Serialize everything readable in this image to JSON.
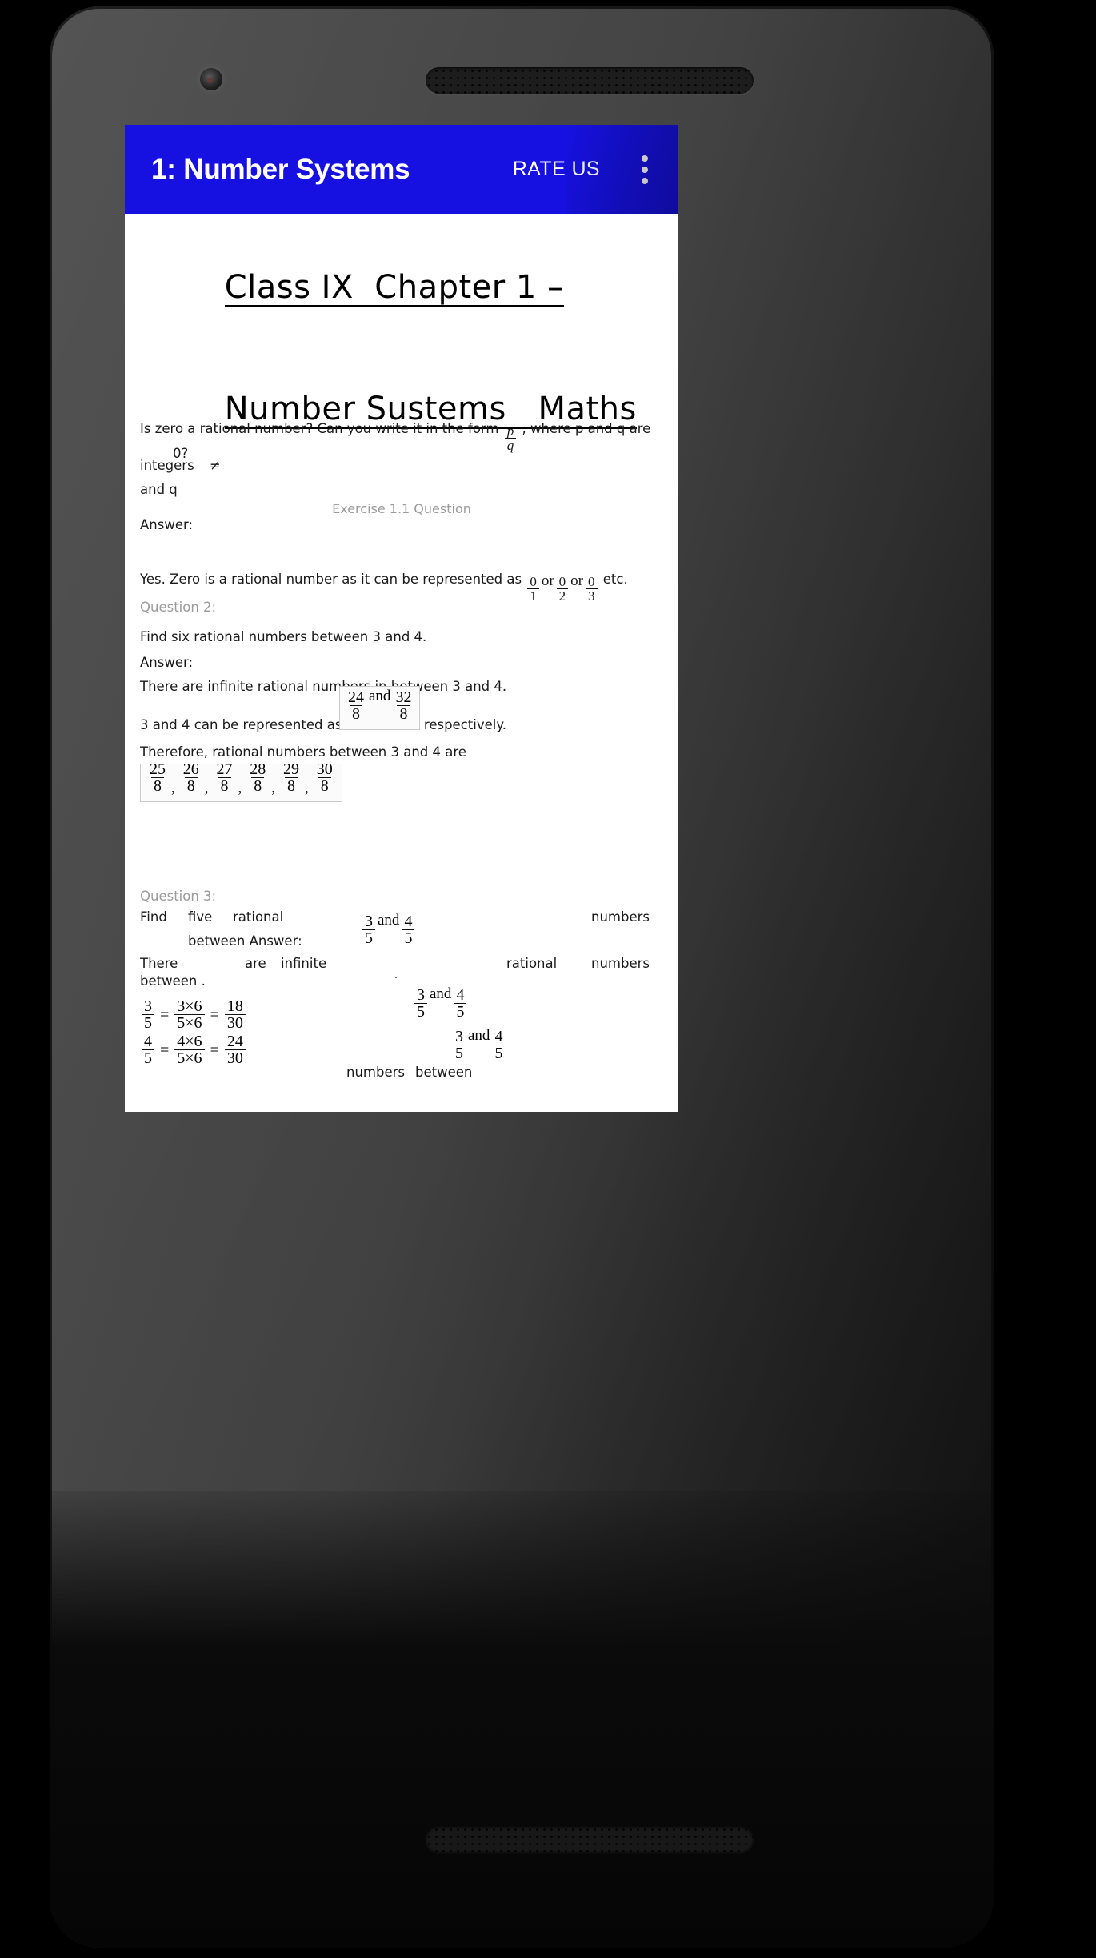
{
  "device": {
    "name": "android-phone-mockup",
    "camera_icon": "front-camera-icon",
    "earpiece_icon": "earpiece-speaker-icon",
    "bottom_speaker_icon": "bottom-speaker-icon",
    "volume_button": "volume-rocker",
    "power_button": "power-button"
  },
  "appbar": {
    "title": "1: Number Systems",
    "rate_us_label": "RATE US",
    "overflow_icon": "more-vert-icon",
    "background_color": "#1611e0",
    "text_color": "#ffffff"
  },
  "document": {
    "heading_line1": "Class IX  Chapter 1 –",
    "heading_line2": "Number Sustems   Maths",
    "exercise_label": "Exercise 1.1 Question",
    "question1": {
      "text_before_fraction": "Is zero a rational number? Can you write it in the form",
      "fraction": {
        "numerator": "p",
        "denominator": "q"
      },
      "text_after_fraction": ", where p and q are integers",
      "neq_symbol": "≠",
      "zero_q": "0?",
      "wrap_fragment": "and q",
      "answer_label": "Answer:",
      "answer_text_before": "Yes. Zero is a rational number as it can be represented as",
      "answer_fractions": [
        {
          "numerator": "0",
          "denominator": "1"
        },
        {
          "numerator": "0",
          "denominator": "2"
        },
        {
          "numerator": "0",
          "denominator": "3"
        }
      ],
      "or_label": "or",
      "answer_text_after": "etc."
    },
    "question2": {
      "label": "Question 2:",
      "text": "Find six rational numbers between 3 and 4.",
      "answer_label": "Answer:",
      "line1": "There are infinite rational numbers in between 3 and 4.",
      "line2_before": "3 and 4 can be represented as",
      "boxed_fractions": [
        {
          "numerator": "24",
          "denominator": "8"
        },
        {
          "numerator": "32",
          "denominator": "8"
        }
      ],
      "and_label": "and",
      "line2_after": "respectively.",
      "line3": "Therefore, rational numbers between 3 and 4 are",
      "result_fractions": [
        {
          "numerator": "25",
          "denominator": "8"
        },
        {
          "numerator": "26",
          "denominator": "8"
        },
        {
          "numerator": "27",
          "denominator": "8"
        },
        {
          "numerator": "28",
          "denominator": "8"
        },
        {
          "numerator": "29",
          "denominator": "8"
        },
        {
          "numerator": "30",
          "denominator": "8"
        }
      ],
      "separator": ","
    },
    "question3": {
      "label": "Question 3:",
      "line1_a": "Find",
      "line1_b": "five",
      "line1_c": "rational",
      "line1_d": "numbers",
      "line2_a": "between Answer:",
      "pair_fraction_left": {
        "numerator": "3",
        "denominator": "5"
      },
      "pair_fraction_right": {
        "numerator": "4",
        "denominator": "5"
      },
      "and_label": "and",
      "line3_a": "There",
      "line3_b": "are",
      "line3_c": "infinite",
      "line3_d": "rational",
      "line3_e": "numbers",
      "line4": "between .",
      "period_mark": ".",
      "equations": [
        {
          "lhs": {
            "numerator": "3",
            "denominator": "5"
          },
          "mid": {
            "numerator": "3×6",
            "denominator": "5×6"
          },
          "rhs": {
            "numerator": "18",
            "denominator": "30"
          },
          "eq": "="
        },
        {
          "lhs": {
            "numerator": "4",
            "denominator": "5"
          },
          "mid": {
            "numerator": "4×6",
            "denominator": "5×6"
          },
          "rhs": {
            "numerator": "24",
            "denominator": "30"
          },
          "eq": "="
        }
      ],
      "numbers_label": "numbers",
      "between_label": "between"
    }
  }
}
